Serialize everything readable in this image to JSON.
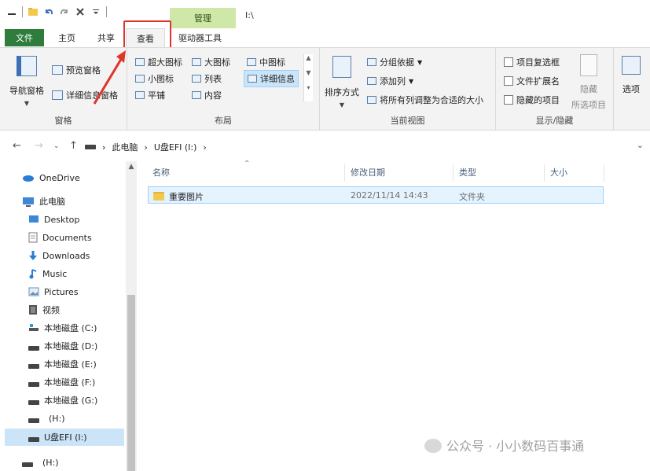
{
  "window": {
    "title": "I:\\",
    "contextual_tab": "管理"
  },
  "tabs": {
    "file": "文件",
    "home": "主页",
    "share": "共享",
    "view": "查看",
    "drive_tools": "驱动器工具"
  },
  "ribbon": {
    "pane": {
      "label": "窗格",
      "nav_pane": "导航窗格",
      "preview": "预览窗格",
      "details": "详细信息窗格"
    },
    "layout": {
      "label": "布局",
      "xl_icons": "超大图标",
      "large_icons": "大图标",
      "medium_icons": "中图标",
      "small_icons": "小图标",
      "list": "列表",
      "details": "详细信息",
      "tiles": "平铺",
      "content": "内容"
    },
    "current_view": {
      "label": "当前视图",
      "sort_by": "排序方式",
      "group_by": "分组依据",
      "add_columns": "添加列",
      "size_all": "将所有列调整为合适的大小"
    },
    "show_hide": {
      "label": "显示/隐藏",
      "item_checkboxes": "项目复选框",
      "file_extensions": "文件扩展名",
      "hidden_items": "隐藏的项目",
      "hide_selected_1": "隐藏",
      "hide_selected_2": "所选项目"
    },
    "options": "选项"
  },
  "address": {
    "root": "此电脑",
    "current": "U盘EFI (I:)"
  },
  "nav": {
    "items": [
      {
        "label": "OneDrive",
        "icon": "cloud-icon"
      },
      {
        "label": "此电脑",
        "icon": "computer-icon"
      },
      {
        "label": "Desktop",
        "icon": "desktop-icon"
      },
      {
        "label": "Documents",
        "icon": "document-icon"
      },
      {
        "label": "Downloads",
        "icon": "download-icon"
      },
      {
        "label": "Music",
        "icon": "music-icon"
      },
      {
        "label": "Pictures",
        "icon": "picture-icon"
      },
      {
        "label": "视频",
        "icon": "video-icon"
      },
      {
        "label": "本地磁盘 (C:)",
        "icon": "windows-drive-icon"
      },
      {
        "label": "本地磁盘 (D:)",
        "icon": "drive-icon"
      },
      {
        "label": "本地磁盘 (E:)",
        "icon": "drive-icon"
      },
      {
        "label": "本地磁盘 (F:)",
        "icon": "drive-icon"
      },
      {
        "label": "本地磁盘 (G:)",
        "icon": "drive-icon"
      },
      {
        "label": "(H:)",
        "icon": "drive-icon"
      },
      {
        "label": "U盘EFI (I:)",
        "icon": "drive-icon"
      },
      {
        "label": "(H:)",
        "icon": "drive-icon"
      }
    ]
  },
  "list": {
    "columns": {
      "name": "名称",
      "date": "修改日期",
      "type": "类型",
      "size": "大小"
    },
    "rows": [
      {
        "name": "重要图片",
        "date": "2022/11/14 14:43",
        "type": "文件夹",
        "size": ""
      }
    ]
  },
  "watermark": "公众号 · 小小数码百事通"
}
